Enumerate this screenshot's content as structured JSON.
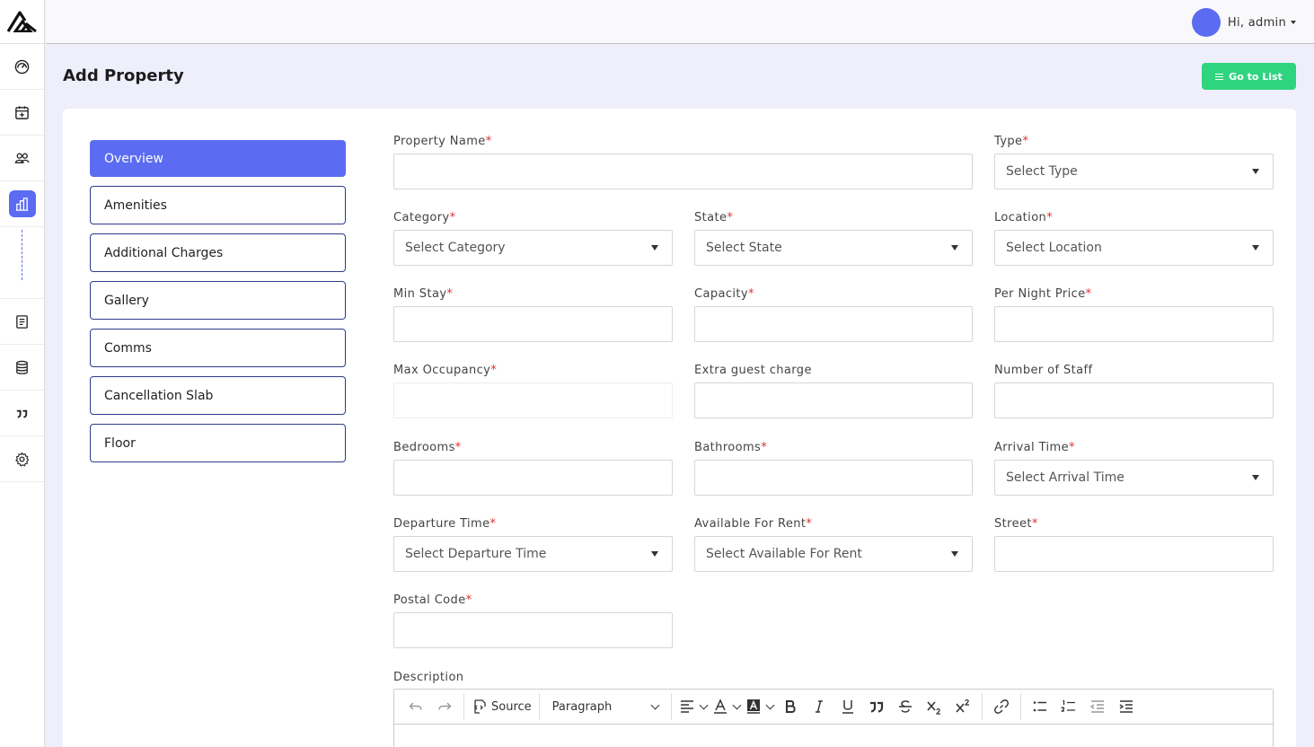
{
  "header": {
    "user_label": "Hi, admin"
  },
  "page": {
    "title": "Add Property",
    "goto_list_label": "Go to List"
  },
  "tabs": [
    {
      "label": "Overview",
      "active": true
    },
    {
      "label": "Amenities",
      "active": false
    },
    {
      "label": "Additional Charges",
      "active": false
    },
    {
      "label": "Gallery",
      "active": false
    },
    {
      "label": "Comms",
      "active": false
    },
    {
      "label": "Cancellation Slab",
      "active": false
    },
    {
      "label": "Floor",
      "active": false
    }
  ],
  "form": {
    "property_name": {
      "label": "Property Name",
      "required": "*",
      "value": ""
    },
    "type": {
      "label": "Type",
      "required": "*",
      "placeholder": "Select Type"
    },
    "category": {
      "label": "Category",
      "required": "*",
      "placeholder": "Select Category"
    },
    "state": {
      "label": "State",
      "required": "*",
      "placeholder": "Select State"
    },
    "location": {
      "label": "Location",
      "required": "*",
      "placeholder": "Select Location"
    },
    "min_stay": {
      "label": "Min Stay",
      "required": "*",
      "value": ""
    },
    "capacity": {
      "label": "Capacity",
      "required": "*",
      "value": ""
    },
    "per_night_price": {
      "label": "Per Night Price",
      "required": "*",
      "value": ""
    },
    "max_occupancy": {
      "label": "Max Occupancy",
      "required": "*",
      "value": ""
    },
    "extra_guest_charge": {
      "label": "Extra guest charge",
      "value": ""
    },
    "number_of_staff": {
      "label": "Number of Staff",
      "value": ""
    },
    "bedrooms": {
      "label": "Bedrooms",
      "required": "*",
      "value": ""
    },
    "bathrooms": {
      "label": "Bathrooms",
      "required": "*",
      "value": ""
    },
    "arrival_time": {
      "label": "Arrival Time",
      "required": "*",
      "placeholder": "Select Arrival Time"
    },
    "departure_time": {
      "label": "Departure Time",
      "required": "*",
      "placeholder": "Select Departure Time"
    },
    "available_for_rent": {
      "label": "Available For Rent",
      "required": "*",
      "placeholder": "Select Available For Rent"
    },
    "street": {
      "label": "Street",
      "required": "*",
      "value": ""
    },
    "postal_code": {
      "label": "Postal Code",
      "required": "*",
      "value": ""
    }
  },
  "editor": {
    "label": "Description",
    "source_label": "Source",
    "paragraph_label": "Paragraph"
  },
  "colors": {
    "accent": "#5b6cf2",
    "success": "#2fd47f",
    "required": "#e03131"
  }
}
